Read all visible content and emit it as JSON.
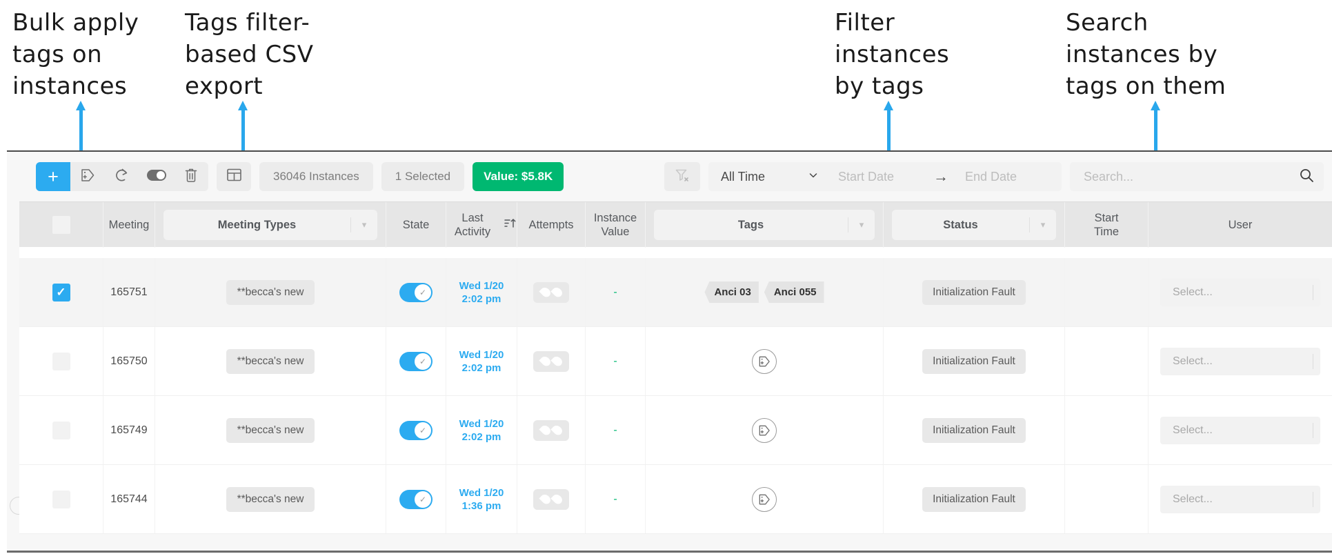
{
  "annotations": [
    {
      "id": "bulk-apply-tags",
      "text": "Bulk apply\ntags on\ninstances"
    },
    {
      "id": "tags-csv-export",
      "text": "Tags filter-\nbased CSV\nexport"
    },
    {
      "id": "filter-by-tags",
      "text": "Filter\ninstances\nby tags"
    },
    {
      "id": "search-by-tags",
      "text": "Search\ninstances by\ntags on them"
    }
  ],
  "toolbar": {
    "add_label": "+",
    "icons": [
      {
        "name": "add-tag-icon",
        "title": "Add tag"
      },
      {
        "name": "redo-icon",
        "title": "Redo"
      },
      {
        "name": "toggle-icon",
        "title": "Toggle"
      },
      {
        "name": "trash-icon",
        "title": "Delete"
      }
    ],
    "grid_icon": "grid-icon",
    "instances_count": "36046 Instances",
    "selected_count": "1 Selected",
    "value_label": "Value: $5.8K",
    "filter_clear_icon": "filter-clear-icon",
    "time_range": "All Time",
    "start_date_placeholder": "Start Date",
    "end_date_placeholder": "End Date",
    "range_arrow": "→",
    "search_placeholder": "Search...",
    "search_value": "",
    "search_icon": "search-icon"
  },
  "table": {
    "columns": [
      {
        "key": "checkbox",
        "label": "",
        "type": "checkbox"
      },
      {
        "key": "meeting",
        "label": "Meeting",
        "type": "text"
      },
      {
        "key": "meeting_types",
        "label": "Meeting Types",
        "type": "select"
      },
      {
        "key": "state",
        "label": "State",
        "type": "text"
      },
      {
        "key": "last_activity",
        "label": "Last\nActivity",
        "type": "sortable",
        "sort_icon": "sort-ascending-icon"
      },
      {
        "key": "attempts",
        "label": "Attempts",
        "type": "text"
      },
      {
        "key": "instance_value",
        "label": "Instance\nValue",
        "type": "text"
      },
      {
        "key": "tags",
        "label": "Tags",
        "type": "select"
      },
      {
        "key": "status",
        "label": "Status",
        "type": "select"
      },
      {
        "key": "start_time",
        "label": "Start\nTime",
        "type": "text"
      },
      {
        "key": "user",
        "label": "User",
        "type": "text"
      }
    ],
    "rows": [
      {
        "selected": true,
        "meeting": "165751",
        "meeting_type": "**becca's new",
        "state_on": true,
        "last_activity": "Wed 1/20\n2:02 pm",
        "attempts": "",
        "instance_value": "-",
        "tags": [
          "Anci 03",
          "Anci 055"
        ],
        "status": "Initialization Fault",
        "start_time": "",
        "user_placeholder": "Select..."
      },
      {
        "selected": false,
        "meeting": "165750",
        "meeting_type": "**becca's new",
        "state_on": true,
        "last_activity": "Wed 1/20\n2:02 pm",
        "attempts": "",
        "instance_value": "-",
        "tags": [],
        "status": "Initialization Fault",
        "start_time": "",
        "user_placeholder": "Select..."
      },
      {
        "selected": false,
        "meeting": "165749",
        "meeting_type": "**becca's new",
        "state_on": true,
        "last_activity": "Wed 1/20\n2:02 pm",
        "attempts": "",
        "instance_value": "-",
        "tags": [],
        "status": "Initialization Fault",
        "start_time": "",
        "user_placeholder": "Select..."
      },
      {
        "selected": false,
        "meeting": "165744",
        "meeting_type": "**becca's new",
        "state_on": true,
        "last_activity": "Wed 1/20\n1:36 pm",
        "attempts": "",
        "instance_value": "-",
        "tags": [],
        "status": "Initialization Fault",
        "start_time": "",
        "user_placeholder": "Select..."
      }
    ],
    "add_tag_icon": "add-tag-circle-icon"
  },
  "colors": {
    "accent_blue": "#2cabf0",
    "annotation_arrow": "#29a7ec",
    "value_green": "#00b871",
    "header_bg": "#e6e6e6",
    "chip_gray": "#e8e8e8"
  }
}
